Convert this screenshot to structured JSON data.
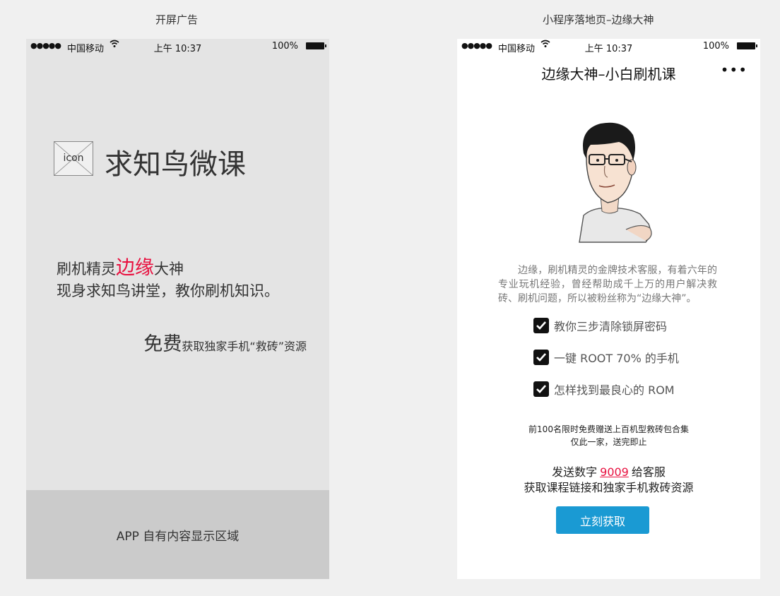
{
  "captions": {
    "left": "开屏广告",
    "right": "小程序落地页–边缘大神"
  },
  "status_bar": {
    "signal": "●●●●●",
    "carrier": "中国移动",
    "time": "上午 10:37",
    "battery": "100%"
  },
  "splash": {
    "icon_label": "icon",
    "brand": "求知鸟微课",
    "promo_prefix": "刷机精灵",
    "promo_highlight": "边缘",
    "promo_suffix": "大神",
    "promo_line2": "现身求知鸟讲堂，教你刷机知识。",
    "free_big": "免费",
    "free_small": "获取独家手机“救砖”资源",
    "app_area": "APP 自有内容显示区域",
    "colors": {
      "highlight": "#e8103f",
      "background": "#e4e4e4",
      "app_area": "#cbcbcb"
    }
  },
  "landing": {
    "title": "边缘大神–小白刷机课",
    "more_icon": "•••",
    "intro": "边缘，刷机精灵的金牌技术客服，有着六年的专业玩机经验，曾经帮助成千上万的用户解决救砖、刷机问题，所以被粉丝称为“边缘大神”。",
    "checklist": [
      "教你三步清除锁屏密码",
      "一键 ROOT 70% 的手机",
      "怎样找到最良心的 ROM"
    ],
    "limited_line1": "前100名限时免费赠送上百机型救砖包合集",
    "limited_line2": "仅此一家，送完即止",
    "send_prefix": "发送数字",
    "send_code": "9009",
    "send_suffix": "给客服",
    "send_line2": "获取课程链接和独家手机救砖资源",
    "cta": "立刻获取",
    "colors": {
      "cta": "#1a9ad3",
      "code": "#e8103f"
    }
  }
}
